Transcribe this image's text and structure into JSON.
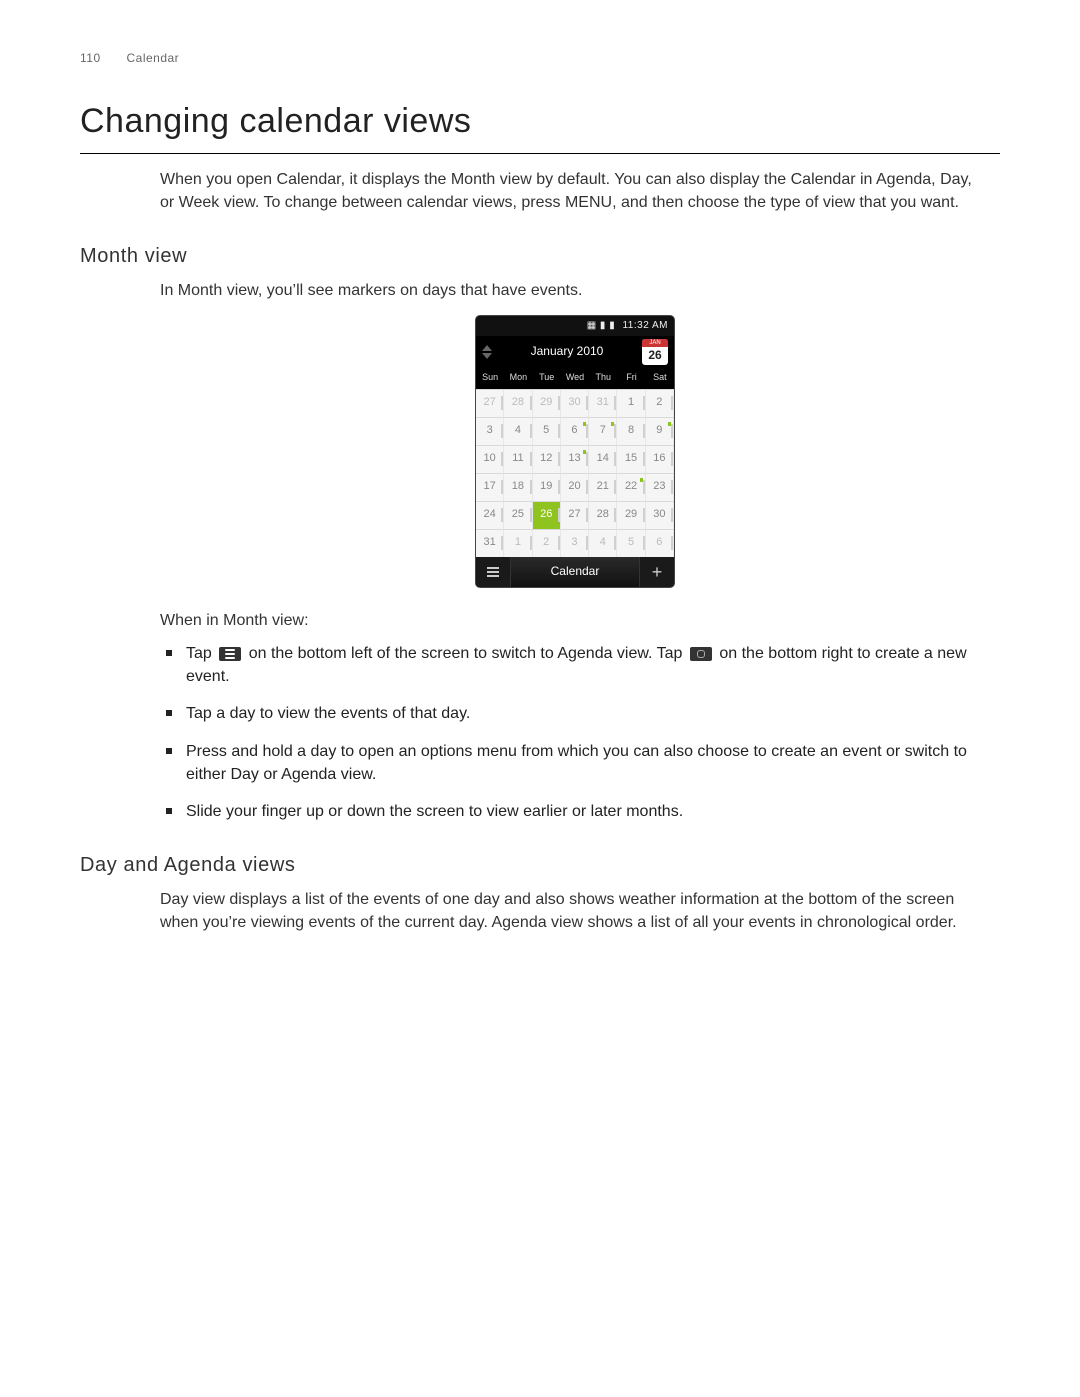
{
  "header": {
    "page_number": "110",
    "section": "Calendar"
  },
  "title": "Changing calendar views",
  "intro": "When you open Calendar, it displays the Month view by default. You can also display the Calendar in Agenda, Day, or Week view. To change between calendar views, press MENU, and then choose the type of view that you want.",
  "month_view": {
    "heading": "Month view",
    "lead": "In Month view, you’ll see markers on days that have events.",
    "after_image": "When in Month view:",
    "bullets": {
      "b1_a": "Tap",
      "b1_b": "on the bottom left of the screen to switch to Agenda view. Tap",
      "b1_c": "on the bottom right to create a new event.",
      "b2": "Tap a day to view the events of that day.",
      "b3": "Press and hold a day to open an options menu from which you can also choose to create an event or switch to either Day or Agenda view.",
      "b4": "Slide your finger up or down the screen to view earlier or later months."
    }
  },
  "day_agenda": {
    "heading": "Day and Agenda views",
    "para": "Day view displays a list of the events of one day and also shows weather information at the bottom of the screen when you’re viewing events of the current day. Agenda view shows a list of all your events in chronological order."
  },
  "phone": {
    "status_time": "11:32 AM",
    "status_icons": "▦ ▮ ▮",
    "month_label": "January 2010",
    "tear_month": "JAN",
    "tear_day": "26",
    "dow": [
      "Sun",
      "Mon",
      "Tue",
      "Wed",
      "Thu",
      "Fri",
      "Sat"
    ],
    "grid": [
      [
        {
          "n": "27",
          "dim": true
        },
        {
          "n": "28",
          "dim": true
        },
        {
          "n": "29",
          "dim": true
        },
        {
          "n": "30",
          "dim": true
        },
        {
          "n": "31",
          "dim": true
        },
        {
          "n": "1"
        },
        {
          "n": "2"
        }
      ],
      [
        {
          "n": "3"
        },
        {
          "n": "4"
        },
        {
          "n": "5"
        },
        {
          "n": "6",
          "ev": true
        },
        {
          "n": "7",
          "ev": true
        },
        {
          "n": "8"
        },
        {
          "n": "9",
          "ev": true
        }
      ],
      [
        {
          "n": "10"
        },
        {
          "n": "11"
        },
        {
          "n": "12"
        },
        {
          "n": "13",
          "ev": true
        },
        {
          "n": "14"
        },
        {
          "n": "15"
        },
        {
          "n": "16"
        }
      ],
      [
        {
          "n": "17"
        },
        {
          "n": "18"
        },
        {
          "n": "19"
        },
        {
          "n": "20"
        },
        {
          "n": "21"
        },
        {
          "n": "22",
          "ev": true
        },
        {
          "n": "23"
        }
      ],
      [
        {
          "n": "24"
        },
        {
          "n": "25"
        },
        {
          "n": "26",
          "today": true
        },
        {
          "n": "27"
        },
        {
          "n": "28"
        },
        {
          "n": "29"
        },
        {
          "n": "30"
        }
      ],
      [
        {
          "n": "31"
        },
        {
          "n": "1",
          "dim": true
        },
        {
          "n": "2",
          "dim": true
        },
        {
          "n": "3",
          "dim": true
        },
        {
          "n": "4",
          "dim": true
        },
        {
          "n": "5",
          "dim": true
        },
        {
          "n": "6",
          "dim": true
        }
      ]
    ],
    "bottom_label": "Calendar"
  }
}
